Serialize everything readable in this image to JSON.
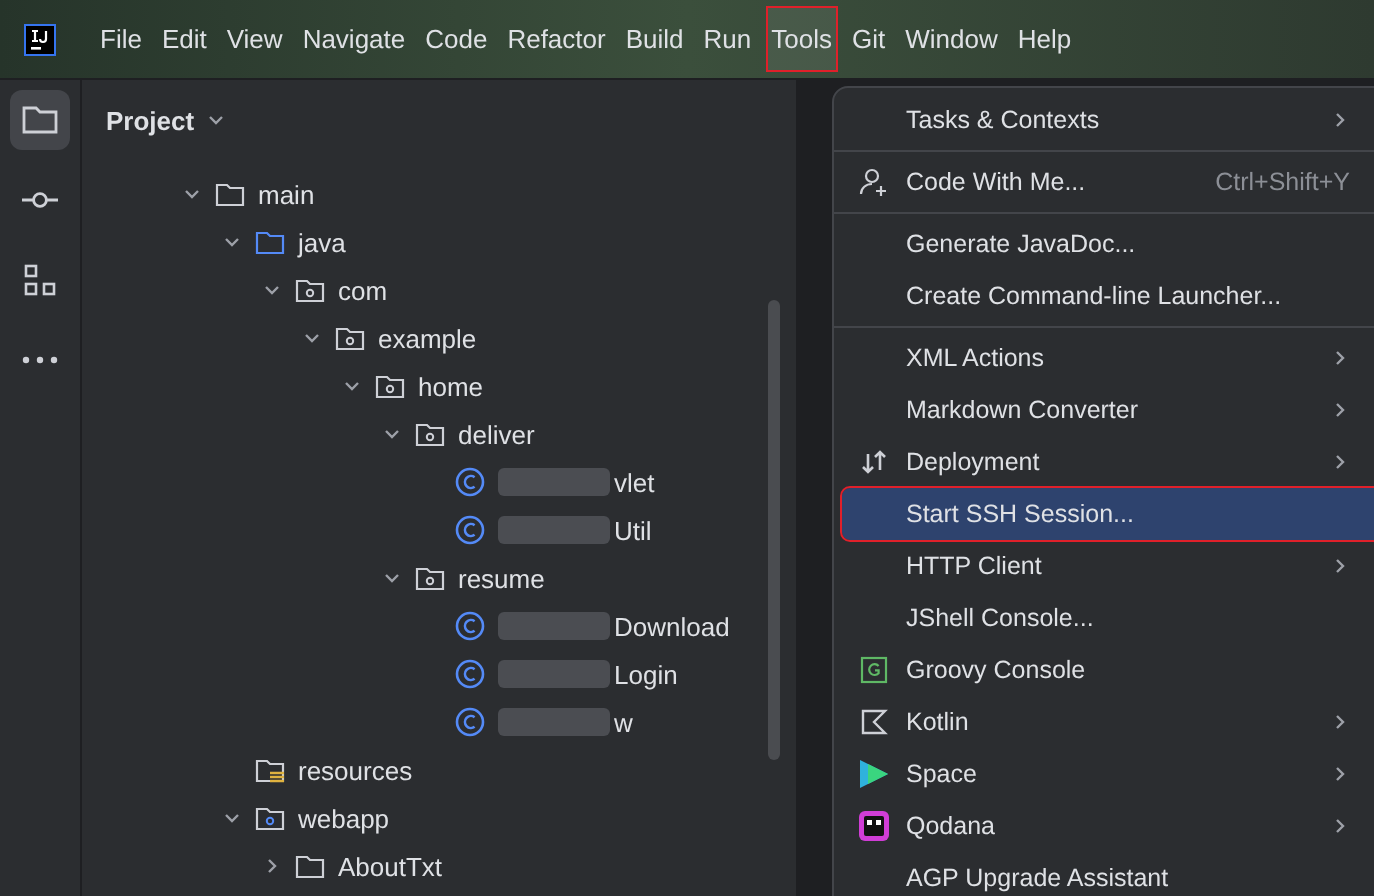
{
  "menubar": [
    {
      "label": "File",
      "selected": false
    },
    {
      "label": "Edit",
      "selected": false
    },
    {
      "label": "View",
      "selected": false
    },
    {
      "label": "Navigate",
      "selected": false
    },
    {
      "label": "Code",
      "selected": false
    },
    {
      "label": "Refactor",
      "selected": false
    },
    {
      "label": "Build",
      "selected": false
    },
    {
      "label": "Run",
      "selected": false
    },
    {
      "label": "Tools",
      "selected": true
    },
    {
      "label": "Git",
      "selected": false
    },
    {
      "label": "Window",
      "selected": false
    },
    {
      "label": "Help",
      "selected": false
    }
  ],
  "tool_strip": [
    {
      "kind": "project",
      "selected": true
    },
    {
      "kind": "commit",
      "selected": false
    },
    {
      "kind": "structure",
      "selected": false
    },
    {
      "kind": "more",
      "selected": false
    }
  ],
  "panel": {
    "title": "Project"
  },
  "tree": [
    {
      "label": "main",
      "kind": "folder",
      "expanded": true,
      "children": [
        {
          "label": "java",
          "kind": "source-folder",
          "expanded": true,
          "children": [
            {
              "label": "com",
              "kind": "package",
              "expanded": true,
              "children": [
                {
                  "label": "example",
                  "kind": "package",
                  "expanded": true,
                  "children": [
                    {
                      "label": "home",
                      "kind": "package",
                      "expanded": true,
                      "children": [
                        {
                          "label": "deliver",
                          "kind": "package",
                          "expanded": true,
                          "children": [
                            {
                              "label": "vlet",
                              "kind": "class",
                              "redacted": true
                            },
                            {
                              "label": "Util",
                              "kind": "class",
                              "redacted": true
                            }
                          ]
                        },
                        {
                          "label": "resume",
                          "kind": "package",
                          "expanded": true,
                          "children": [
                            {
                              "label": "Download",
                              "kind": "class",
                              "redacted": true
                            },
                            {
                              "label": "Login",
                              "kind": "class",
                              "redacted": true
                            },
                            {
                              "label": "w",
                              "kind": "class",
                              "redacted": true
                            }
                          ]
                        }
                      ]
                    }
                  ]
                }
              ]
            }
          ]
        },
        {
          "label": "resources",
          "kind": "resources"
        },
        {
          "label": "webapp",
          "kind": "web-folder",
          "expanded": true,
          "children": [
            {
              "label": "AboutTxt",
              "kind": "folder",
              "expanded": false
            }
          ]
        }
      ]
    }
  ],
  "menu": {
    "groups": [
      {
        "items": [
          {
            "label": "Tasks & Contexts",
            "submenu": true,
            "selected": false
          }
        ]
      },
      {
        "items": [
          {
            "label": "Code With Me...",
            "kind": "people-add",
            "shortcut": "Ctrl+Shift+Y",
            "selected": false
          }
        ]
      },
      {
        "items": [
          {
            "label": "Generate JavaDoc...",
            "selected": false
          },
          {
            "label": "Create Command-line Launcher...",
            "selected": false
          }
        ]
      },
      {
        "items": [
          {
            "label": "XML Actions",
            "submenu": true,
            "selected": false
          },
          {
            "label": "Markdown Converter",
            "submenu": true,
            "selected": false
          },
          {
            "label": "Deployment",
            "kind": "deploy",
            "submenu": true,
            "selected": false
          },
          {
            "label": "Start SSH Session...",
            "selected": true
          },
          {
            "label": "HTTP Client",
            "submenu": true,
            "selected": false
          },
          {
            "label": "JShell Console...",
            "selected": false
          },
          {
            "label": "Groovy Console",
            "kind": "groovy",
            "selected": false
          },
          {
            "label": "Kotlin",
            "kind": "kotlin",
            "submenu": true,
            "selected": false
          },
          {
            "label": "Space",
            "kind": "space",
            "submenu": true,
            "selected": false
          },
          {
            "label": "Qodana",
            "kind": "qodana",
            "submenu": true,
            "selected": false
          },
          {
            "label": "AGP Upgrade Assistant",
            "selected": false
          }
        ]
      }
    ]
  }
}
